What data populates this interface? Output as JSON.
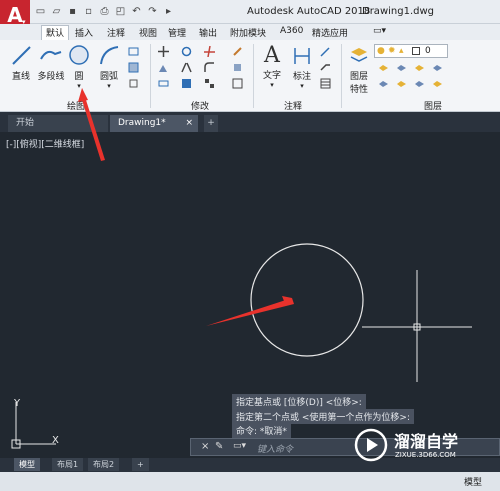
{
  "app": {
    "logo_letter": "A",
    "title": "Autodesk AutoCAD 2018",
    "document": "Drawing1.dwg"
  },
  "ribbon_tabs": [
    "默认",
    "插入",
    "注释",
    "视图",
    "管理",
    "输出",
    "附加模块",
    "A360",
    "精选应用"
  ],
  "draw_panel": {
    "line": "直线",
    "polyline": "多段线",
    "circle": "圆",
    "arc": "圆弧",
    "label": "绘图"
  },
  "modify_panel": {
    "label": "修改"
  },
  "annotate_panel": {
    "text": "文字",
    "dimension": "标注",
    "label": "注释"
  },
  "layers_panel": {
    "props": "图层\n特性",
    "props_line1": "图层",
    "props_line2": "特性",
    "label": "图层",
    "current_layer": "0"
  },
  "doc_tabs": {
    "start": "开始",
    "drawing": "Drawing1*",
    "plus": "+"
  },
  "viewport_label": "[-][俯视][二维线框]",
  "command_history": [
    "指定基点或 [位移(D)] <位移>:",
    "指定第二个点或 <使用第一个点作为位移>:",
    "命令: *取消*"
  ],
  "command_input": {
    "placeholder": "键入命令"
  },
  "layout_tabs": [
    "模型",
    "布局1",
    "布局2",
    "+"
  ],
  "status": {
    "model": "模型"
  },
  "ucs": {
    "x": "X",
    "y": "Y"
  },
  "watermark": {
    "brand": "溜溜自学",
    "url": "ZIXUE.3D66.COM"
  },
  "colors": {
    "canvas": "#212830",
    "annotation_arrow": "#e8322c",
    "logo": "#c8252f"
  }
}
